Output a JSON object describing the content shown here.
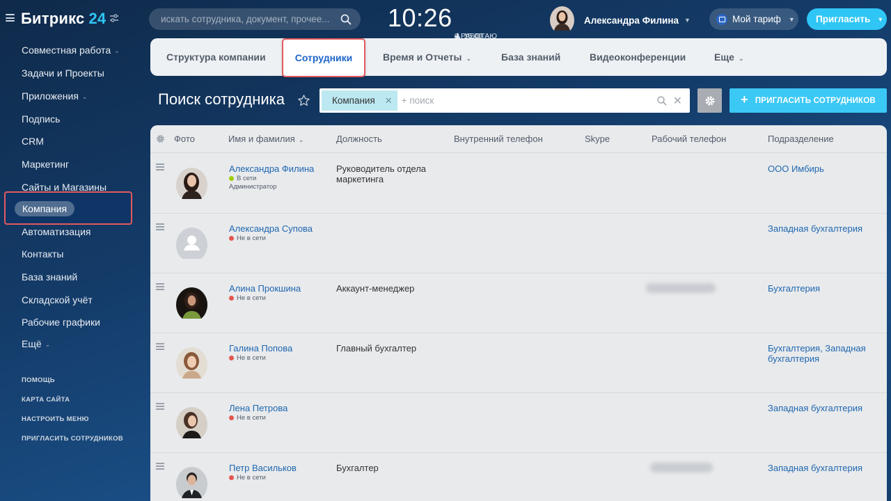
{
  "header": {
    "logo_text": "Битрикс",
    "logo_num": "24",
    "search_placeholder": "искать сотрудника, документ, прочее...",
    "clock": "10:26",
    "clock_alarm": "15:00",
    "work_status": "РАБОТАЮ",
    "user_name": "Александра Филина",
    "tariff_label": "Мой тариф",
    "invite_label": "Пригласить"
  },
  "sidebar": {
    "items": [
      {
        "label": "Совместная работа",
        "has_chevron": true
      },
      {
        "label": "Задачи и Проекты"
      },
      {
        "label": "Приложения",
        "has_chevron": true
      },
      {
        "label": "Подпись"
      },
      {
        "label": "CRM"
      },
      {
        "label": "Маркетинг"
      },
      {
        "label": "Сайты и Магазины"
      },
      {
        "label": "Компания",
        "active": true
      },
      {
        "label": "Автоматизация"
      },
      {
        "label": "Контакты"
      },
      {
        "label": "База знаний"
      },
      {
        "label": "Складской учёт"
      },
      {
        "label": "Рабочие графики"
      },
      {
        "label": "Ещё"
      }
    ],
    "footer": [
      "ПОМОЩЬ",
      "КАРТА САЙТА",
      "НАСТРОИТЬ МЕНЮ",
      "ПРИГЛАСИТЬ СОТРУДНИКОВ"
    ]
  },
  "tabs": [
    {
      "label": "Структура компании"
    },
    {
      "label": "Сотрудники",
      "active": true
    },
    {
      "label": "Время и Отчеты",
      "has_chevron": true
    },
    {
      "label": "База знаний"
    },
    {
      "label": "Видеоконференции"
    },
    {
      "label": "Еще",
      "has_chevron": true
    }
  ],
  "page": {
    "title": "Поиск сотрудника",
    "filter_chip": "Компания",
    "filter_placeholder": "+ поиск",
    "invite_button": "ПРИГЛАСИТЬ СОТРУДНИКОВ"
  },
  "table": {
    "columns": [
      "Фото",
      "Имя и фамилия",
      "Должность",
      "Внутренний телефон",
      "Skype",
      "Рабочий телефон",
      "Подразделение"
    ],
    "rows": [
      {
        "name": "Александра Филина",
        "status": "В сети",
        "online": true,
        "role": "Администратор",
        "position": "Руководитель отдела маркетинга",
        "dept": "ООО Имбирь",
        "phone_blurred": false,
        "avatar": "photo"
      },
      {
        "name": "Александра Супова",
        "status": "Не в сети",
        "online": false,
        "role": "",
        "position": "",
        "dept": "Западная бухгалтерия",
        "phone_blurred": false,
        "avatar": "placeholder"
      },
      {
        "name": "Алина Прокшина",
        "status": "Не в сети",
        "online": false,
        "role": "",
        "position": "Аккаунт-менеджер",
        "dept": "Бухгалтерия",
        "phone_blurred": true,
        "avatar": "photo"
      },
      {
        "name": "Галина Попова",
        "status": "Не в сети",
        "online": false,
        "role": "",
        "position": "Главный бухгалтер",
        "dept": "Бухгалтерия, Западная бухгалтерия",
        "phone_blurred": false,
        "avatar": "photo"
      },
      {
        "name": "Лена Петрова",
        "status": "Не в сети",
        "online": false,
        "role": "",
        "position": "",
        "dept": "Западная бухгалтерия",
        "phone_blurred": false,
        "avatar": "photo"
      },
      {
        "name": "Петр Васильков",
        "status": "Не в сети",
        "online": false,
        "role": "",
        "position": "Бухгалтер",
        "dept": "Западная бухгалтерия",
        "phone_blurred": true,
        "avatar": "photo"
      }
    ]
  },
  "colors": {
    "accent": "#2fc6f6",
    "link": "#2067b0",
    "highlight": "#e35a60",
    "online": "#9dcf00",
    "offline": "#e3564f"
  }
}
